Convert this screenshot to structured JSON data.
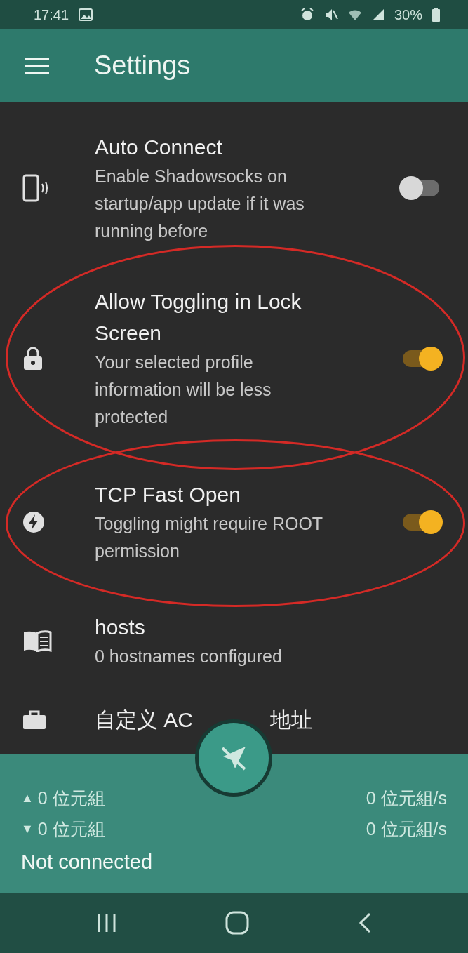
{
  "status_bar": {
    "time": "17:41",
    "battery": "30%"
  },
  "app_bar": {
    "title": "Settings"
  },
  "settings": [
    {
      "kind": "switch",
      "title": "Auto Connect",
      "summary": "Enable Shadowsocks on startup/app update if it was running before",
      "on": false,
      "highlighted": false
    },
    {
      "kind": "switch",
      "title": "Allow Toggling in Lock Screen",
      "summary": "Your selected profile information will be less protected",
      "on": true,
      "highlighted": true
    },
    {
      "kind": "switch",
      "title": "TCP Fast Open",
      "summary": "Toggling might require ROOT permission",
      "on": true,
      "highlighted": true
    },
    {
      "kind": "info",
      "title": "hosts",
      "summary": "0 hostnames configured"
    },
    {
      "kind": "info",
      "title": "自定义 AC",
      "title_tail": "地址"
    }
  ],
  "traffic": {
    "upload_marker": "▲",
    "upload_total": "0 位元組",
    "upload_rate": "0 位元組/s",
    "download_marker": "▼",
    "download_total": "0 位元組",
    "download_rate": "0 位元組/s",
    "status": "Not connected"
  }
}
